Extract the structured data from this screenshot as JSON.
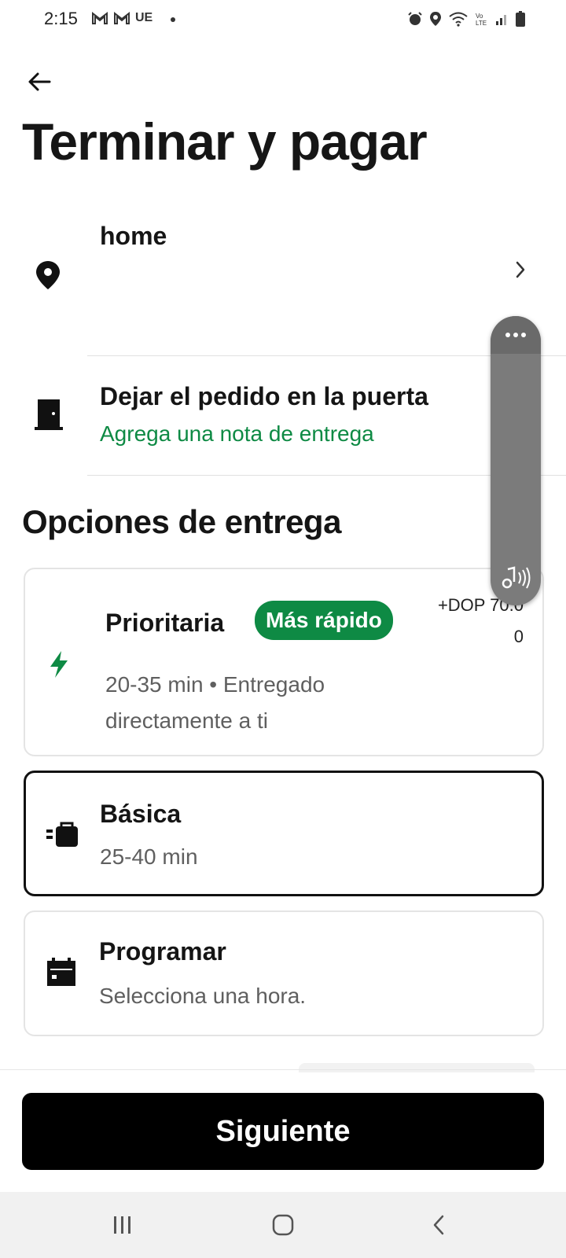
{
  "status_bar": {
    "time": "2:15",
    "carrier": "UE",
    "left_icons": [
      "gmail-icon",
      "gmail-icon"
    ],
    "right_icons": [
      "alarm-icon",
      "location-icon",
      "wifi-icon",
      "volte-icon",
      "signal-icon",
      "battery-icon"
    ]
  },
  "header": {
    "title": "Terminar y pagar"
  },
  "address": {
    "label": "home"
  },
  "dropoff": {
    "title": "Dejar el pedido en la puerta",
    "note_link": "Agrega una nota de entrega"
  },
  "delivery_options": {
    "section_title": "Opciones de entrega",
    "options": [
      {
        "title": "Prioritaria",
        "badge": "Más rápido",
        "price_line1": "+DOP 70.0",
        "price_line2": "0",
        "subtitle_line1": "20-35 min • Entregado",
        "subtitle_line2": "directamente a ti",
        "selected": false
      },
      {
        "title": "Básica",
        "subtitle_line1": "25-40 min",
        "selected": true
      },
      {
        "title": "Programar",
        "subtitle_line1": "Selecciona una hora.",
        "selected": false
      }
    ]
  },
  "footer": {
    "next_label": "Siguiente"
  },
  "colors": {
    "accent_green": "#0e8a44",
    "primary_button": "#000000",
    "selected_border": "#111111"
  }
}
